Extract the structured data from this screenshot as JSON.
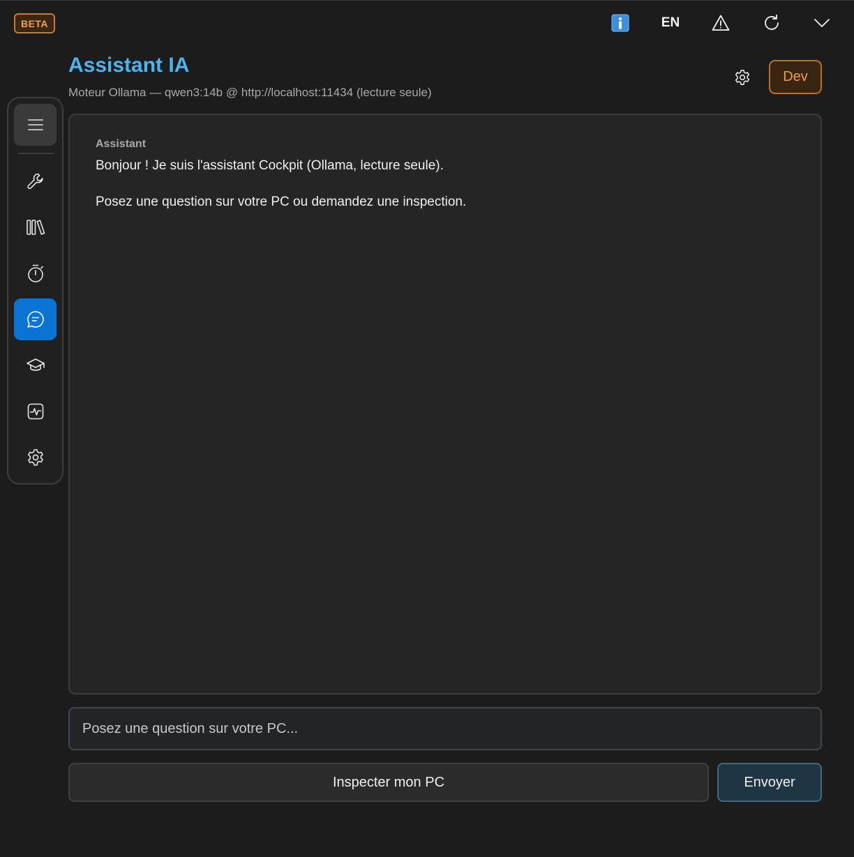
{
  "titlebar": {
    "beta_label": "BETA",
    "language_label": "EN",
    "icons": [
      "info-icon",
      "warning-icon",
      "refresh-icon",
      "chevron-down-icon"
    ]
  },
  "sidebar": {
    "items": [
      {
        "icon": "menu-icon",
        "active": false
      },
      {
        "icon": "wrench-icon",
        "active": false
      },
      {
        "icon": "library-icon",
        "active": false
      },
      {
        "icon": "stopwatch-icon",
        "active": false
      },
      {
        "icon": "chat-icon",
        "active": true
      },
      {
        "icon": "graduation-cap-icon",
        "active": false
      },
      {
        "icon": "activity-icon",
        "active": false
      },
      {
        "icon": "gear-icon",
        "active": false
      }
    ],
    "active_color": "#0a74d4"
  },
  "header": {
    "title": "Assistant IA",
    "subtitle": "Moteur Ollama — qwen3:14b @ http://localhost:11434 (lecture seule)",
    "dev_label": "Dev",
    "title_color": "#4cb4ee",
    "dev_color": "#f29c42"
  },
  "chat": {
    "messages": [
      {
        "author": "Assistant",
        "lines": [
          "Bonjour ! Je suis l'assistant Cockpit (Ollama, lecture seule).",
          "Posez une question sur votre PC ou demandez une inspection."
        ]
      }
    ]
  },
  "input": {
    "value": "",
    "placeholder": "Posez une question sur votre PC..."
  },
  "actions": {
    "inspect_label": "Inspecter mon PC",
    "send_label": "Envoyer"
  }
}
